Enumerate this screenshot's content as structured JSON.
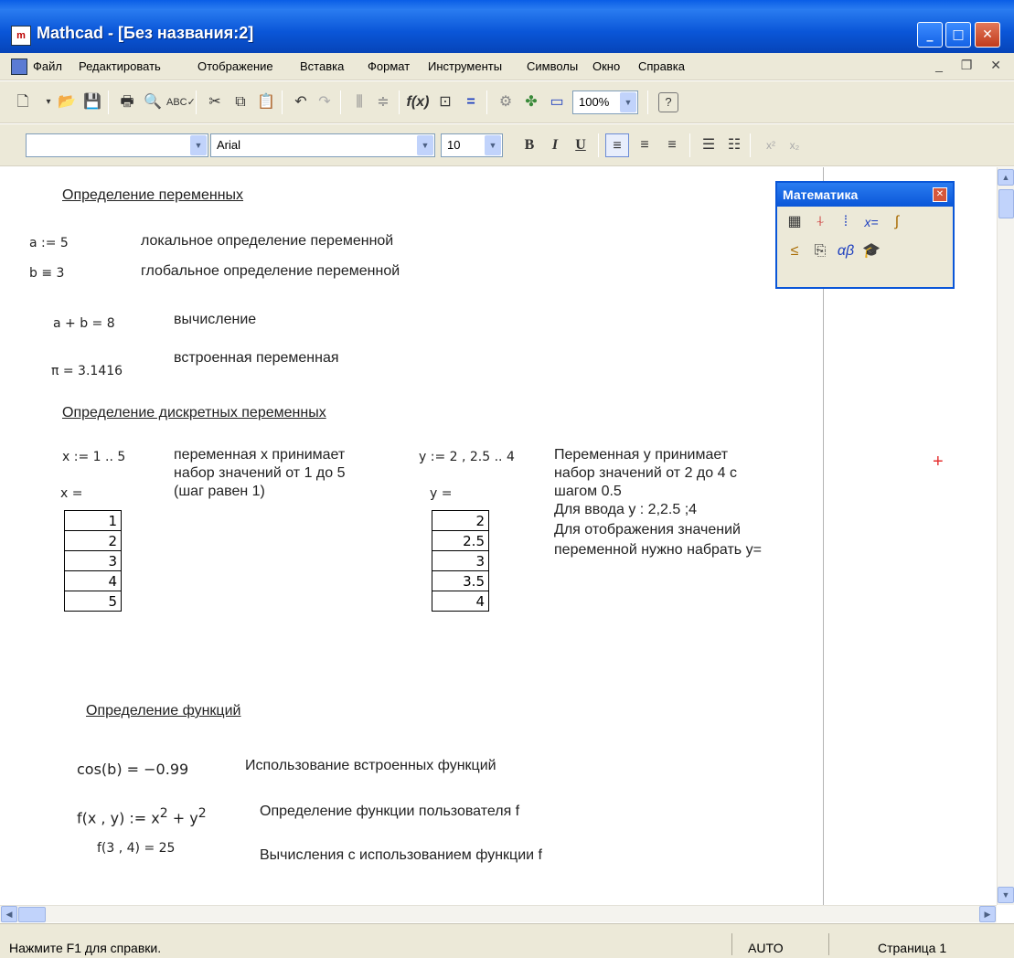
{
  "window": {
    "app_icon": "mathcad-icon",
    "title": "Mathcad - [Без названия:2]"
  },
  "menu": {
    "items": [
      "Файл",
      "Редактировать",
      "Отображение",
      "Вставка",
      "Формат",
      "Инструменты",
      "Символы",
      "Окно",
      "Справка"
    ]
  },
  "toolbar": {
    "zoom": "100%"
  },
  "format_bar": {
    "style": "",
    "font": "Arial",
    "size": "10",
    "bold": "B",
    "italic": "I",
    "underline": "U"
  },
  "math_palette": {
    "title": "Математика"
  },
  "document": {
    "h_vars": "Определение переменных",
    "expr_a": "a := 5",
    "desc_a": "локальное определение переменной",
    "expr_b": "b ≡ 3",
    "desc_b": "глобальное определение переменной",
    "expr_sum": "a + b = 8",
    "desc_sum": "вычисление",
    "desc_pi": "встроенная переменная",
    "expr_pi": "π = 3.1416",
    "h_discrete": "Определение дискретных переменных",
    "expr_x": "x := 1 .. 5",
    "desc_x": [
      "переменная x принимает",
      "набор значений от 1 до 5",
      "(шаг равен 1)"
    ],
    "expr_y": "y := 2 , 2.5 .. 4",
    "desc_y": [
      "Переменная y принимает",
      "набор значений от 2 до 4 с",
      "шагом 0.5",
      "Для ввода y : 2,2.5 ;4",
      "Для отображения значений",
      "переменной нужно набрать y="
    ],
    "x_eq": "x =",
    "y_eq": "y =",
    "x_values": [
      "1",
      "2",
      "3",
      "4",
      "5"
    ],
    "y_values": [
      "2",
      "2.5",
      "3",
      "3.5",
      "4"
    ],
    "h_func": "Определение функций",
    "expr_cos": "cos(b) = −0.99",
    "desc_cos": "Использование встроенных функций",
    "expr_f_def_lhs": "f(x , y) := x",
    "expr_f_def_mid": " + y",
    "expr_f_def_exp": "2",
    "desc_f_def": "Определение функции пользователя f",
    "expr_f_call": "f(3 , 4) = 25",
    "desc_f_call": "Вычисления с использованием функции f"
  },
  "status": {
    "help": "Нажмите F1 для справки.",
    "mode": "AUTO",
    "page": "Страница 1"
  }
}
